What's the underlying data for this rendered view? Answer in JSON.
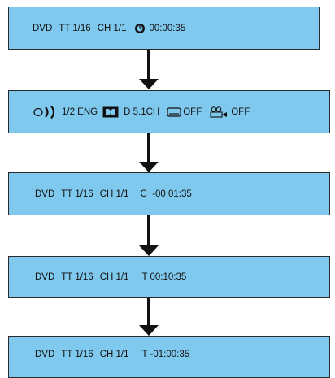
{
  "panels": [
    {
      "disc": "DVD",
      "title": "TT 1/16",
      "chapter": "CH 1/1",
      "time": "00:00:35",
      "time_icon": "clock-icon"
    },
    {
      "audio": "1/2 ENG",
      "audio_icon": "audio-waves-icon",
      "dolby_icon": "dolby-icon",
      "sound": "D 5.1CH",
      "subtitle": "OFF",
      "subtitle_icon": "subtitle-icon",
      "angle": "OFF",
      "angle_icon": "camera-angle-icon"
    },
    {
      "disc": "DVD",
      "title": "TT 1/16",
      "chapter": "CH 1/1",
      "time": "C  -00:01:35"
    },
    {
      "disc": "DVD",
      "title": "TT 1/16",
      "chapter": "CH 1/1",
      "time": "T 00:10:35"
    },
    {
      "disc": "DVD",
      "title": "TT 1/16",
      "chapter": "CH 1/1",
      "time": "T -01:00:35"
    }
  ],
  "colors": {
    "panel_bg": "#80c9ee",
    "border": "#2a2a2a",
    "arrow": "#111111"
  }
}
